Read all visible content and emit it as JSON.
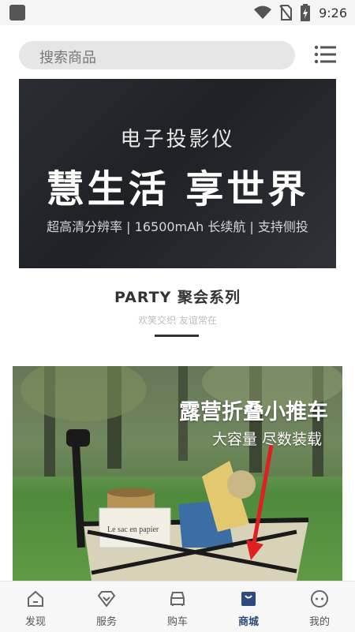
{
  "status": {
    "time": "9:26"
  },
  "search": {
    "placeholder": "搜索商品"
  },
  "banner": {
    "subtitle": "电子投影仪",
    "title": "慧生活 享世界",
    "features": "超高清分辨率 | 16500mAh 长续航 | 支持侧投"
  },
  "section": {
    "title": "PARTY  聚会系列",
    "subtitle": "欢笑交织  友谊常在"
  },
  "promo": {
    "title": "露营折叠小推车",
    "subtitle": "大容量 尽数装载",
    "bag_text": "Le sac en papier"
  },
  "nav": {
    "items": [
      {
        "label": "发现",
        "icon": "home-icon"
      },
      {
        "label": "服务",
        "icon": "diamond-icon"
      },
      {
        "label": "购车",
        "icon": "car-icon"
      },
      {
        "label": "商城",
        "icon": "shop-icon",
        "active": true
      },
      {
        "label": "我的",
        "icon": "profile-icon"
      }
    ],
    "active_color": "#2c4a7e"
  }
}
